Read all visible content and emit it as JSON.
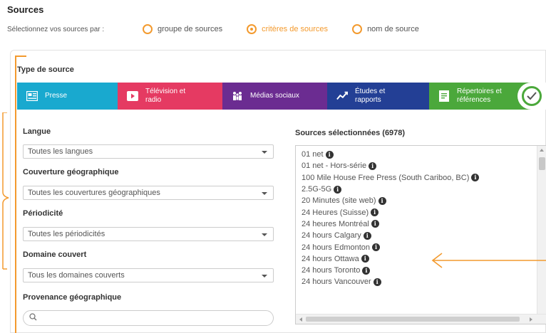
{
  "header": {
    "title": "Sources",
    "selector_label": "Sélectionnez vos sources par :",
    "options": [
      {
        "label": "groupe de sources",
        "checked": false
      },
      {
        "label": "critères de sources",
        "checked": true
      },
      {
        "label": "nom de source",
        "checked": false
      }
    ]
  },
  "type_section": {
    "label": "Type de source",
    "tabs": [
      {
        "label": "Presse",
        "icon": "newspaper-icon",
        "color": "#19a9cf"
      },
      {
        "label": "Télévision et radio",
        "icon": "play-icon",
        "color": "#e53a62"
      },
      {
        "label": "Médias sociaux",
        "icon": "people-icon",
        "color": "#6b2c91"
      },
      {
        "label": "Études et rapports",
        "icon": "trend-icon",
        "color": "#233f95"
      },
      {
        "label": "Répertoires et références",
        "icon": "document-icon",
        "color": "#4ba83b"
      }
    ]
  },
  "filters": {
    "langue": {
      "label": "Langue",
      "value": "Toutes les langues"
    },
    "couverture": {
      "label": "Couverture géographique",
      "value": "Toutes les couvertures géographiques"
    },
    "periodicite": {
      "label": "Périodicité",
      "value": "Toutes les périodicités"
    },
    "domaine": {
      "label": "Domaine couvert",
      "value": "Tous les domaines couverts"
    },
    "provenance": {
      "label": "Provenance géographique",
      "placeholder": ""
    }
  },
  "selected": {
    "title": "Sources sélectionnées (6978)",
    "items": [
      "01 net",
      "01 net - Hors-série",
      "100 Mile House Free Press (South Cariboo, BC)",
      "2.5G-5G",
      "20 Minutes (site web)",
      "24 Heures (Suisse)",
      "24 heures Montréal",
      "24 hours Calgary",
      "24 hours Edmonton",
      "24 hours Ottawa",
      "24 hours Toronto",
      "24 hours Vancouver"
    ]
  },
  "colors": {
    "accent": "#f39a2e"
  }
}
